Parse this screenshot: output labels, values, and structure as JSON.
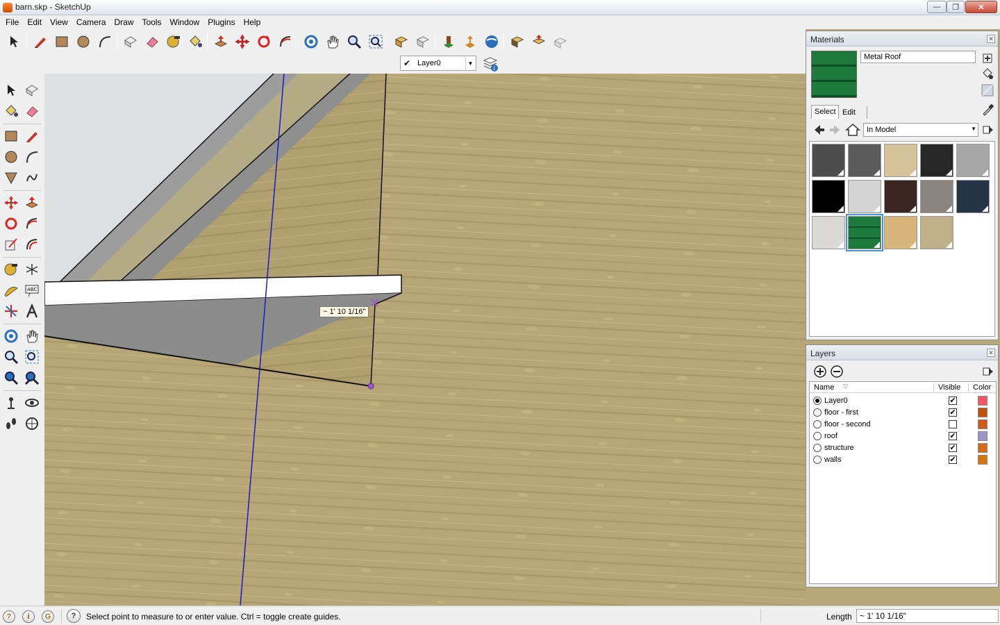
{
  "window": {
    "title": "barn.skp - SketchUp"
  },
  "menu": [
    "File",
    "Edit",
    "View",
    "Camera",
    "Draw",
    "Tools",
    "Window",
    "Plugins",
    "Help"
  ],
  "layer_toolbar": {
    "current_layer": "Layer0"
  },
  "viewport": {
    "tooltip": "~ 1' 10 1/16\""
  },
  "materials": {
    "title": "Materials",
    "current_name": "Metal Roof",
    "tabs": [
      "Select",
      "Edit"
    ],
    "collection": "In Model",
    "swatches": [
      {
        "color": "#4c4c4c"
      },
      {
        "color": "#5b5b5b"
      },
      {
        "color": "#d6c29a"
      },
      {
        "color": "#262626"
      },
      {
        "color": "#a6a6a6"
      },
      {
        "color": "#000000"
      },
      {
        "color": "#d4d4d4"
      },
      {
        "color": "#3a2520"
      },
      {
        "color": "#8a8480"
      },
      {
        "color": "#243348"
      },
      {
        "color": "#dcdad8"
      },
      {
        "color": "#1e7a3c"
      },
      {
        "color": "#d8b57a"
      },
      {
        "color": "#bfb08a"
      }
    ],
    "selected_swatch": 11
  },
  "layers": {
    "title": "Layers",
    "columns": {
      "name": "Name",
      "visible": "Visible",
      "color": "Color"
    },
    "rows": [
      {
        "name": "Layer0",
        "active": true,
        "visible": true,
        "color": "#f25563"
      },
      {
        "name": "floor - first",
        "active": false,
        "visible": true,
        "color": "#c0500a"
      },
      {
        "name": "floor - second",
        "active": false,
        "visible": false,
        "color": "#d05a10"
      },
      {
        "name": "roof",
        "active": false,
        "visible": true,
        "color": "#9a97c8"
      },
      {
        "name": "structure",
        "active": false,
        "visible": true,
        "color": "#d86a14"
      },
      {
        "name": "walls",
        "active": false,
        "visible": true,
        "color": "#d6740a"
      }
    ]
  },
  "status": {
    "message": "Select point to measure to or enter value.  Ctrl = toggle create guides.",
    "measure_label": "Length",
    "measure_value": "~ 1' 10 1/16\""
  }
}
